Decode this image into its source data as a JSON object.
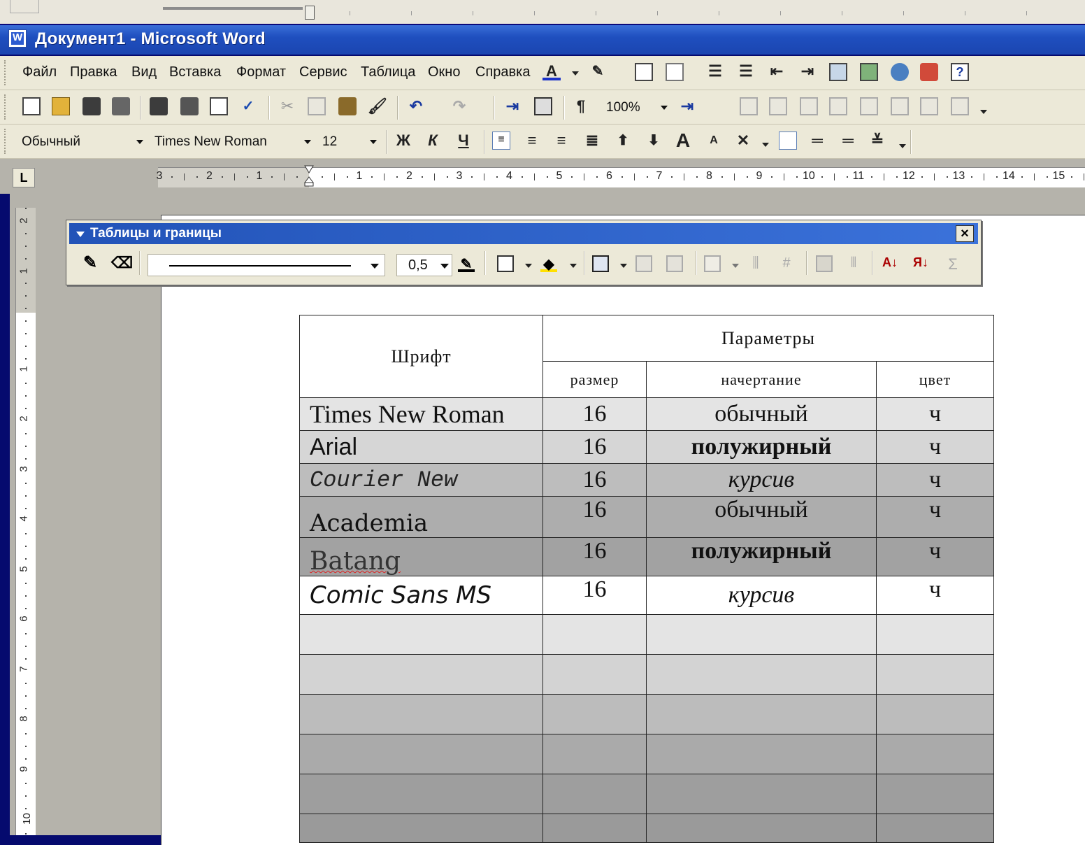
{
  "window": {
    "title": "Документ1 - Microsoft Word",
    "app_icon": "word-icon"
  },
  "menu": {
    "items": [
      "Файл",
      "Правка",
      "Вид",
      "Вставка",
      "Формат",
      "Сервис",
      "Таблица",
      "Окно",
      "Справка"
    ]
  },
  "standard_toolbar": {
    "zoom": "100%"
  },
  "formatting_toolbar": {
    "style": "Обычный",
    "font": "Times New Roman",
    "size": "12",
    "bold": "Ж",
    "italic": "К",
    "underline": "Ч"
  },
  "ruler": {
    "corner": "L",
    "h_numbers": [
      "3",
      "2",
      "1",
      "1",
      "2",
      "3",
      "4",
      "5",
      "6",
      "7",
      "8",
      "9",
      "10",
      "11",
      "12",
      "13",
      "14",
      "15"
    ],
    "v_numbers": [
      "2",
      "1",
      "1",
      "2",
      "3",
      "4",
      "5",
      "6",
      "7",
      "8",
      "9",
      "10"
    ]
  },
  "tables_toolbar": {
    "title": "Таблицы и границы",
    "close": "×",
    "line_weight": "0,5"
  },
  "table": {
    "header": {
      "font_col": "Шрифт",
      "params": "Параметры",
      "size_col": "размер",
      "style_col": "начертание",
      "color_col": "цвет"
    },
    "rows": [
      {
        "font": "Times New Roman",
        "size": "16",
        "style": "обычный",
        "color": "ч"
      },
      {
        "font": "Arial",
        "size": "16",
        "style": "полужирный",
        "color": "ч"
      },
      {
        "font": "Courier New",
        "size": "16",
        "style": "курсив",
        "color": "ч"
      },
      {
        "font": "Academia",
        "size": "16",
        "style": "обычный",
        "color": "ч"
      },
      {
        "font": "Batang",
        "size": "16",
        "style": "полужирный",
        "color": "ч"
      },
      {
        "font": "Comic Sans MS",
        "size": "16",
        "style": "курсив",
        "color": "ч"
      }
    ]
  }
}
